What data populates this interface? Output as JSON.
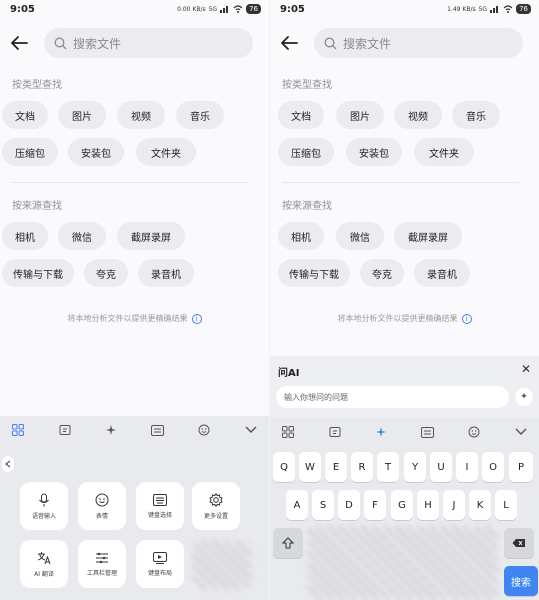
{
  "status": {
    "time": "9:05",
    "left_speed": "0.00 KB/s",
    "right_speed": "1.49 KB/s",
    "net": "5G",
    "battery": "76"
  },
  "search": {
    "placeholder": "搜索文件"
  },
  "type_section": {
    "title": "按类型查找",
    "chips": [
      "文档",
      "图片",
      "视频",
      "音乐",
      "压缩包",
      "安装包",
      "文件夹"
    ]
  },
  "source_section": {
    "title": "按来源查找",
    "chips": [
      "相机",
      "微信",
      "截屏录屏",
      "传输与下载",
      "夸克",
      "录音机"
    ]
  },
  "hint": "将本地分析文件以提供更精确结果",
  "left_panel": {
    "tiles": [
      {
        "label": "语音输入",
        "icon": "microphone-icon"
      },
      {
        "label": "表情",
        "icon": "emoji-icon"
      },
      {
        "label": "键盘选择",
        "icon": "keyboard-icon"
      },
      {
        "label": "更多设置",
        "icon": "gear-icon"
      },
      {
        "label": "AI 翻译",
        "icon": "translate-icon"
      },
      {
        "label": "工具栏管理",
        "icon": "toolbar-icon"
      },
      {
        "label": "键盘布局",
        "icon": "layout-icon"
      }
    ]
  },
  "ai_panel": {
    "title": "问AI",
    "input_placeholder": "输入你想问的问题"
  },
  "keyboard": {
    "row1": [
      "Q",
      "W",
      "E",
      "R",
      "T",
      "Y",
      "U",
      "I",
      "O",
      "P"
    ],
    "row2": [
      "A",
      "S",
      "D",
      "F",
      "G",
      "H",
      "J",
      "K",
      "L"
    ],
    "search_label": "搜索"
  }
}
